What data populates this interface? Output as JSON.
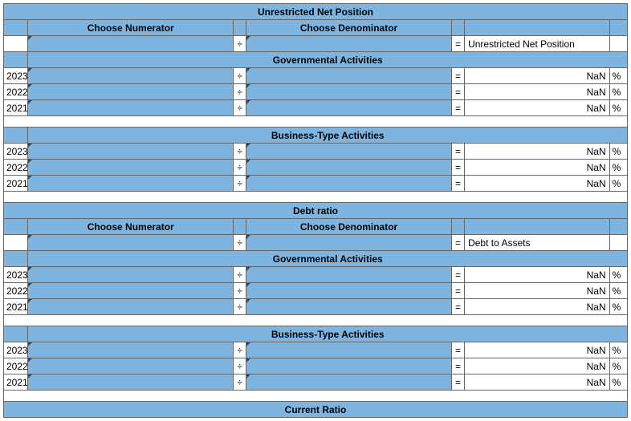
{
  "symbols": {
    "divide": "÷",
    "equals": "=",
    "percent": "%"
  },
  "sections": [
    {
      "title": "Unrestricted Net Position",
      "numerator_header": "Choose Numerator",
      "denominator_header": "Choose Denominator",
      "result_label": "Unrestricted Net Position",
      "groups": [
        {
          "name": "Governmental Activities",
          "rows": [
            {
              "year": "2023",
              "numerator": "",
              "denominator": "",
              "result": "NaN"
            },
            {
              "year": "2022",
              "numerator": "",
              "denominator": "",
              "result": "NaN"
            },
            {
              "year": "2021",
              "numerator": "",
              "denominator": "",
              "result": "NaN"
            }
          ]
        },
        {
          "name": "Business-Type Activities",
          "rows": [
            {
              "year": "2023",
              "numerator": "",
              "denominator": "",
              "result": "NaN"
            },
            {
              "year": "2022",
              "numerator": "",
              "denominator": "",
              "result": "NaN"
            },
            {
              "year": "2021",
              "numerator": "",
              "denominator": "",
              "result": "NaN"
            }
          ]
        }
      ]
    },
    {
      "title": "Debt ratio",
      "numerator_header": "Choose Numerator",
      "denominator_header": "Choose Denominator",
      "result_label": "Debt to Assets",
      "groups": [
        {
          "name": "Governmental Activities",
          "rows": [
            {
              "year": "2023",
              "numerator": "",
              "denominator": "",
              "result": "NaN"
            },
            {
              "year": "2022",
              "numerator": "",
              "denominator": "",
              "result": "NaN"
            },
            {
              "year": "2021",
              "numerator": "",
              "denominator": "",
              "result": "NaN"
            }
          ]
        },
        {
          "name": "Business-Type Activities",
          "rows": [
            {
              "year": "2023",
              "numerator": "",
              "denominator": "",
              "result": "NaN"
            },
            {
              "year": "2022",
              "numerator": "",
              "denominator": "",
              "result": "NaN"
            },
            {
              "year": "2021",
              "numerator": "",
              "denominator": "",
              "result": "NaN"
            }
          ]
        }
      ]
    },
    {
      "title": "Current Ratio"
    }
  ]
}
